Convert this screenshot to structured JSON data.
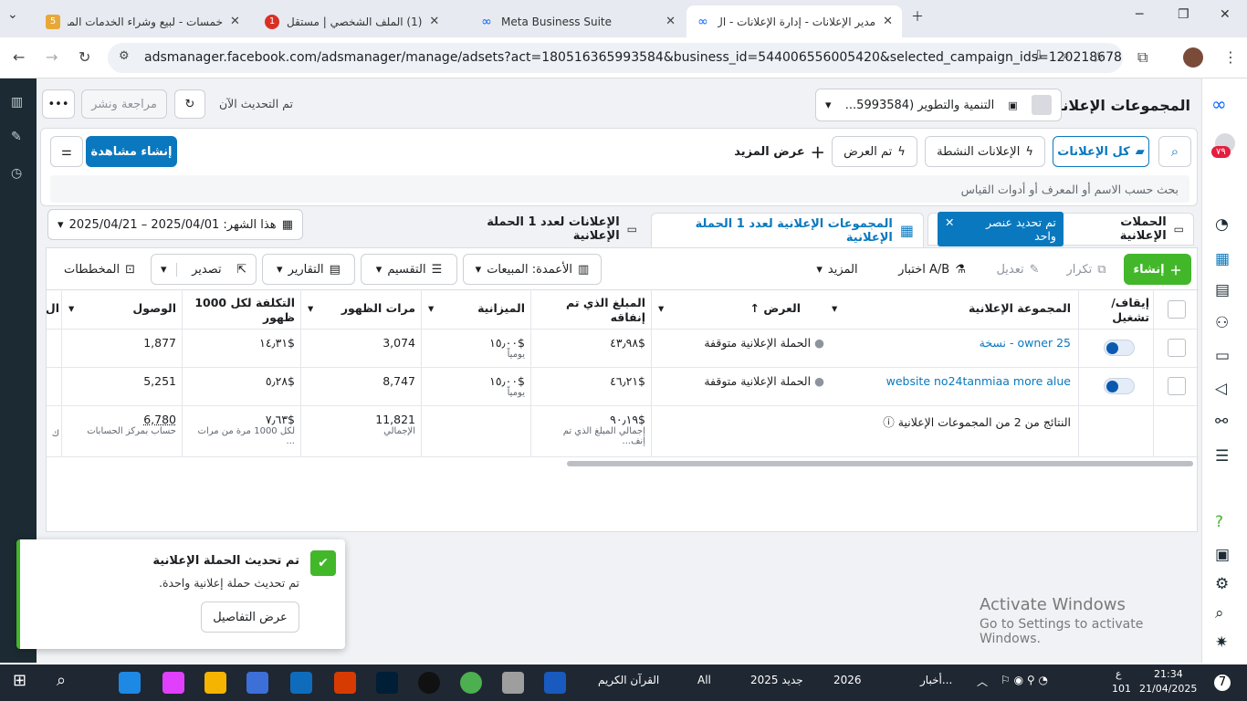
{
  "browser": {
    "tabs": [
      {
        "title": "خمسات - لبيع وشراء الخدمات المص",
        "badge": "5"
      },
      {
        "title": "(1) الملف الشخصي | مستقل"
      },
      {
        "title": "Meta Business Suite"
      },
      {
        "title": "مدير الإعلانات - إدارة الإعلانات - ال"
      }
    ],
    "url": "adsmanager.facebook.com/adsmanager/manage/adsets?act=180516365993584&business_id=544006556005420&selected_campaign_ids=120218678519..."
  },
  "header": {
    "title": "المجموعات الإعلانية",
    "account": "التنمية والتطوير (5993584...",
    "update_status": "تم التحديث الآن",
    "review_publish": "مراجعة ونشر",
    "more": "•••"
  },
  "toolbar": {
    "all_ads": "كل الإعلانات",
    "active_ads": "الإعلانات النشطة",
    "shown": "تم العرض",
    "see_more": "عرض المزيد",
    "create_view": "إنشاء مشاهدة",
    "search_placeholder": "بحث حسب الاسم أو المعرف أو أدوات القياس"
  },
  "date_range": "هذا الشهر: 2025/04/01 – 2025/04/21",
  "level_tabs": {
    "campaigns": "الحملات الإعلانية",
    "selected_chip": "تم تحديد عنصر واحد",
    "adsets": "المجموعات الإعلانية لعدد 1 الحملة الإعلانية",
    "ads": "الإعلانات لعدد 1 الحملة الإعلانية"
  },
  "actions": {
    "create": "إنشاء",
    "duplicate": "تكرار",
    "edit": "تعديل",
    "ab_test": "اختبار A/B",
    "more": "المزيد",
    "columns": "الأعمدة: المبيعات",
    "breakdown": "التقسيم",
    "reports": "التقارير",
    "export": "تصدير",
    "charts": "المخططات"
  },
  "table": {
    "headers": {
      "toggle": "إيقاف/ تشغيل",
      "adset": "المجموعة الإعلانية",
      "delivery": "العرض ↑",
      "spent": "المبلغ الذي تم إنفاقه",
      "budget": "الميزانية",
      "impressions": "مرات الظهور",
      "cpm": "التكلفة لكل 1000 ظهور",
      "reach": "الوصول",
      "cut": "ال"
    },
    "rows": [
      {
        "name": "owner 25 - نسخة",
        "delivery": "الحملة الإعلانية متوقفة",
        "spent": "$٤٣٫٩٨",
        "budget": "$١٥٫٠٠",
        "budget_note": "يومياً",
        "impressions": "3,074",
        "cpm": "$١٤٫٣١",
        "reach": "1,877"
      },
      {
        "name": "website no24tanmiaa more alue",
        "delivery": "الحملة الإعلانية متوقفة",
        "spent": "$٤٦٫٢١",
        "budget": "$١٥٫٠٠",
        "budget_note": "يومياً",
        "impressions": "8,747",
        "cpm": "$٥٫٢٨",
        "reach": "5,251"
      }
    ],
    "totals": {
      "label": "النتائج من 2 من المجموعات الإعلانية",
      "spent": "$٩٠٫١٩",
      "spent_note": "إجمالي المبلغ الذي تم إنف...",
      "impressions": "11,821",
      "impressions_note": "الإجمالي",
      "cpm": "$٧٫٦٣",
      "cpm_note": "لكل 1000 مرة من مرات ...",
      "reach": "6,780",
      "reach_note": "حساب بمركز الحسابات",
      "cut_note": "ك"
    }
  },
  "toast": {
    "title": "تم تحديث الحملة الإعلانية",
    "body": "تم تحديث حملة إعلانية واحدة.",
    "button": "عرض التفاصيل"
  },
  "watermark": {
    "line1": "Activate Windows",
    "line2": "Go to Settings to activate Windows."
  },
  "rightnav_badge": "٧٩",
  "taskbar": {
    "time": "21:34",
    "date": "21/04/2025",
    "lang_top": "ع",
    "lang_bottom": "101",
    "notif": "7",
    "news": "أخبار...",
    "items": [
      "2026",
      "جديد 2025",
      "All",
      "القرآن الكريم"
    ]
  }
}
